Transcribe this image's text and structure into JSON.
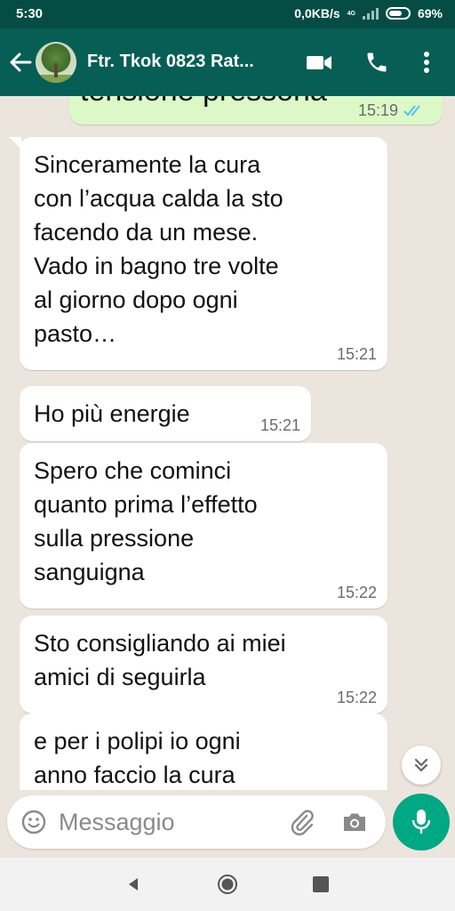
{
  "status_bar": {
    "time": "5:30",
    "data_rate": "0,0KB/s",
    "network_badge_top": "4G",
    "network_badge_bottom": "",
    "battery": "69%",
    "battery_level": 0.69
  },
  "header": {
    "title": "Ftr. Tkok 0823 Rat...",
    "icons": [
      "back-arrow-icon",
      "video-call-icon",
      "phone-icon",
      "more-vert-icon"
    ]
  },
  "messages": [
    {
      "direction": "out",
      "text": "tensione pressoria",
      "time": "15:19",
      "status": "read"
    },
    {
      "direction": "in",
      "lines": [
        "Sinceramente la cura",
        "con l’acqua calda la sto",
        "facendo da un mese.",
        "Vado in bagno tre volte",
        "al giorno dopo ogni",
        "pasto…"
      ],
      "time": "15:21"
    },
    {
      "direction": "in",
      "lines": [
        "Ho più energie"
      ],
      "time": "15:21"
    },
    {
      "direction": "in",
      "lines": [
        "Spero che cominci",
        "quanto prima l’effetto",
        "sulla pressione",
        "sanguigna"
      ],
      "time": "15:22"
    },
    {
      "direction": "in",
      "lines": [
        "Sto consigliando ai miei",
        "amici di seguirla"
      ],
      "time": "15:22"
    },
    {
      "direction": "in",
      "lines": [
        "e per i polipi io ogni",
        "anno faccio la cura"
      ],
      "time": ""
    }
  ],
  "composer": {
    "placeholder": "Messaggio"
  },
  "colors": {
    "header": "#075e54",
    "status_bar": "#054d44",
    "chat_background": "#ece5dd",
    "incoming_bubble": "#ffffff",
    "outgoing_bubble": "#dcf8c6",
    "accent": "#00a884",
    "read_ticks": "#4fc3f7"
  }
}
